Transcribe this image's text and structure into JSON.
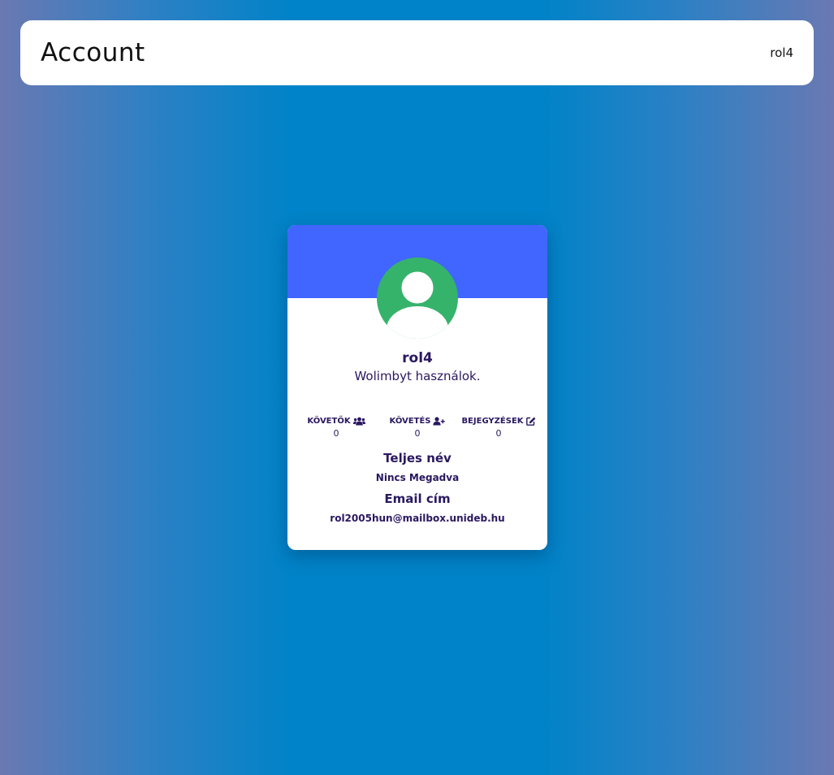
{
  "header": {
    "title": "Account",
    "username": "rol4"
  },
  "profile": {
    "avatar_icon": "user-silhouette-icon",
    "username": "rol4",
    "bio": "Wolimbyt használok.",
    "stats": [
      {
        "label": "KÖVETŐK",
        "icon": "users-icon",
        "value": "0"
      },
      {
        "label": "KÖVETÉS",
        "icon": "user-plus-icon",
        "value": "0"
      },
      {
        "label": "BEJEGYZÉSEK",
        "icon": "edit-icon",
        "value": "0"
      }
    ],
    "full_name_title": "Teljes név",
    "full_name_value": "Nincs Megadva",
    "email_title": "Email cím",
    "email_value": "rol2005hun@mailbox.unideb.hu"
  },
  "colors": {
    "banner": "#4066ff",
    "avatar": "#35b36b",
    "text": "#2a1860",
    "background": "#0083c8"
  }
}
